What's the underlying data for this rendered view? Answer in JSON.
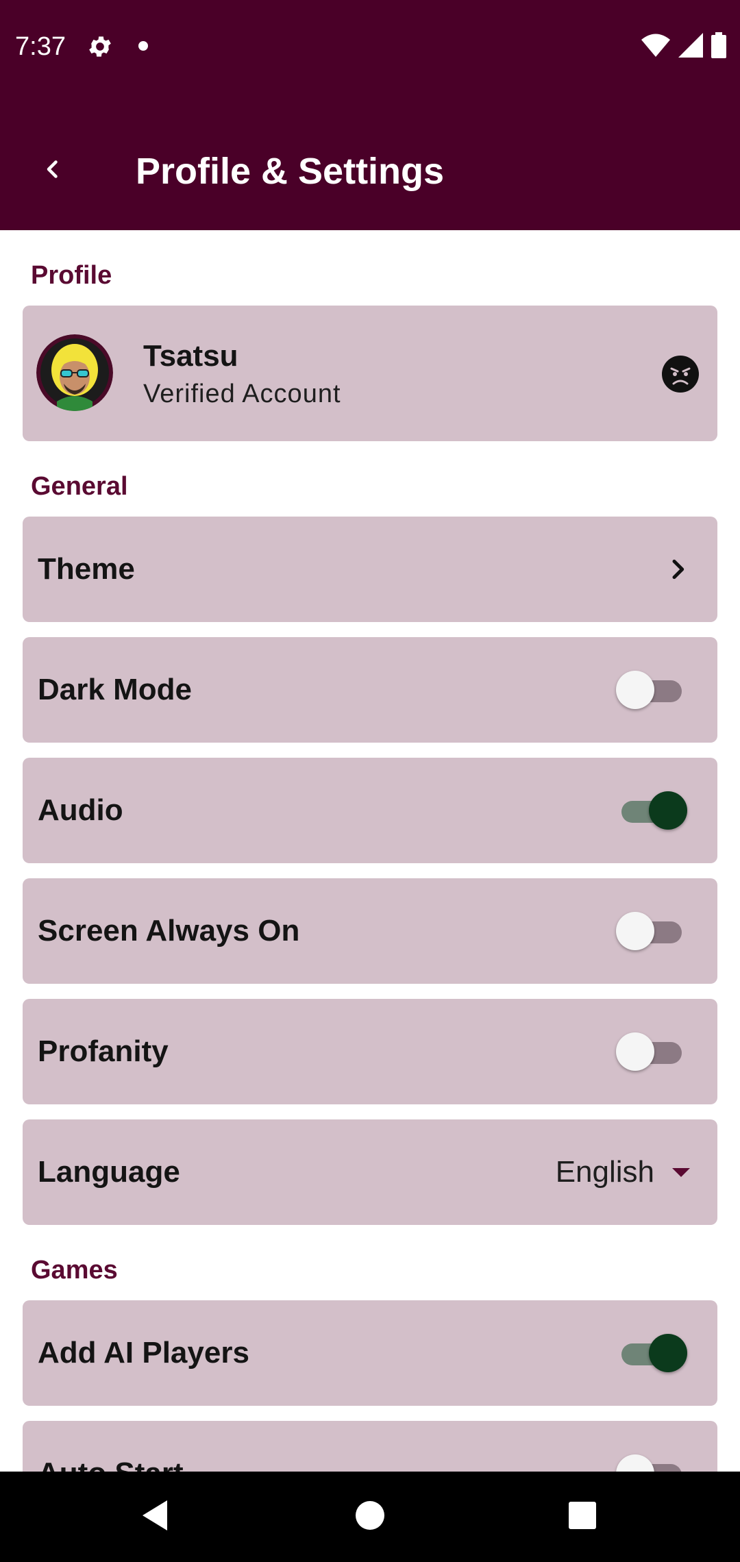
{
  "status_bar": {
    "time": "7:37",
    "icons": [
      "settings-icon",
      "notification-dot-icon",
      "wifi-icon",
      "cell-signal-icon",
      "battery-icon"
    ]
  },
  "app_bar": {
    "title": "Profile & Settings",
    "back_icon": "back-arrow-icon"
  },
  "colors": {
    "primary": "#4a0028",
    "card": "#d3bfc9",
    "section_label": "#5a0a32",
    "toggle_on": "#0b3a1c"
  },
  "sections": {
    "profile": "Profile",
    "general": "General",
    "games": "Games"
  },
  "profile": {
    "name": "Tsatsu",
    "subtitle": "Verified Account",
    "status_icon": "angry-face-icon"
  },
  "general": {
    "theme": {
      "label": "Theme"
    },
    "dark_mode": {
      "label": "Dark Mode",
      "on": false
    },
    "audio": {
      "label": "Audio",
      "on": true
    },
    "screen_always_on": {
      "label": "Screen Always On",
      "on": false
    },
    "profanity": {
      "label": "Profanity",
      "on": false
    },
    "language": {
      "label": "Language",
      "value": "English"
    }
  },
  "games": {
    "add_ai_players": {
      "label": "Add AI Players",
      "on": true
    },
    "auto_start": {
      "label": "Auto Start",
      "on": false
    }
  },
  "nav_bar": {
    "icons": [
      "back-triangle-icon",
      "home-circle-icon",
      "recents-square-icon"
    ]
  }
}
